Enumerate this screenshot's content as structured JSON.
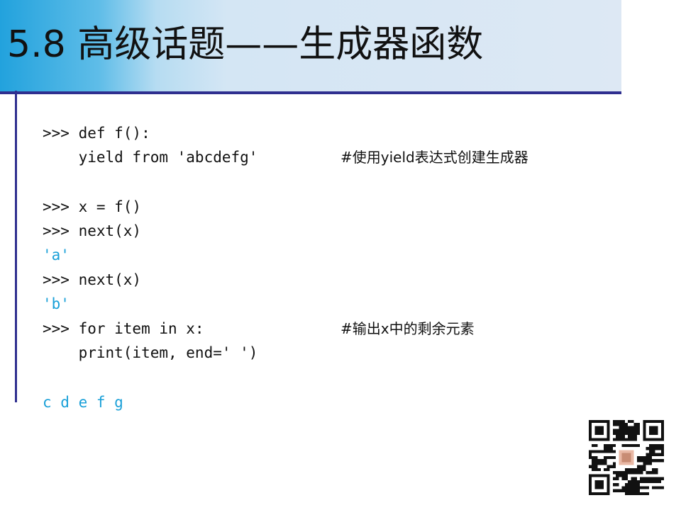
{
  "slide": {
    "title": "5.8 高级话题——生成器函数"
  },
  "code": {
    "lines": [
      ">>> def f():",
      "    yield from 'abcdefg'",
      "",
      ">>> x = f()",
      ">>> next(x)",
      "'a'",
      ">>> next(x)",
      "'b'",
      ">>> for item in x:",
      "    print(item, end=' ')",
      "",
      "c d e f g"
    ],
    "comment_generator": "#使用yield表达式创建生成器",
    "comment_loop": "#输出x中的剩余元素"
  },
  "colors": {
    "code_text": "#111111",
    "output_text": "#1aa0d8",
    "title_accent": "#22a2dd",
    "rule": "#2f2f8f"
  },
  "icons": {
    "qr": "qr-code-icon"
  }
}
